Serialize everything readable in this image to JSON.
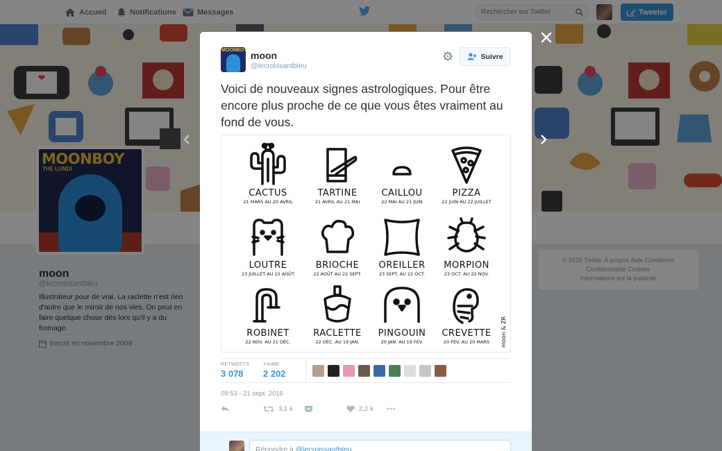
{
  "nav": {
    "home_label": "Accueil",
    "notifications_label": "Notifications",
    "messages_label": "Messages",
    "search_placeholder": "Rechercher sur Twitter",
    "tweet_button": "Tweeter"
  },
  "profile": {
    "avatar_title": "MOONBOY",
    "avatar_subtitle": "THE LUNDI",
    "name": "moon",
    "handle": "@lecroissantbleu",
    "bio": "Illustrateur pour de vrai. La raclette n'est rien d'autre que le miroir de nos vies. On peut en faire quelque chose dès lors qu'il y a du fromage.",
    "joined": "Inscrit en novembre 2009"
  },
  "footer": {
    "line1": "© 2016 Twitter   À propos   Aide   Conditions",
    "line2": "Confidentialité   Cookies",
    "line3": "Informations sur la publicité"
  },
  "tweet": {
    "author_name": "moon",
    "author_handle": "@lecroissantbleu",
    "follow_label": "Suivre",
    "text": "Voici de nouveaux signes astrologiques. Pour être encore plus proche de ce que vous êtes vraiment au fond de vous.",
    "retweets_label": "RETWEETS",
    "retweets_value": "3 078",
    "likes_label": "J'AIME",
    "likes_value": "2 202",
    "timestamp": "09:53 - 21 sept. 2016",
    "retweet_count": "3,1 k",
    "like_count": "2,2 k",
    "more_label": "•••",
    "reply_prefix": "Répondre à ",
    "reply_handle": "@lecroissantbleu"
  },
  "signs": [
    {
      "name": "CACTUS",
      "dates": "21 MARS AU 20 AVRIL",
      "icon": "cactus-icon"
    },
    {
      "name": "TARTINE",
      "dates": "21 AVRIL AU 21 MAI",
      "icon": "tartine-icon"
    },
    {
      "name": "CAILLOU",
      "dates": "22 MAI AU 21 JUIN",
      "icon": "caillou-icon"
    },
    {
      "name": "PIZZA",
      "dates": "22 JUIN AU 22 JUILLET",
      "icon": "pizza-icon"
    },
    {
      "name": "LOUTRE",
      "dates": "23 JUILLET AU 22 AOÛT",
      "icon": "loutre-icon"
    },
    {
      "name": "BRIOCHE",
      "dates": "22 AOÛT AU 22 SEPT.",
      "icon": "brioche-icon"
    },
    {
      "name": "OREILLER",
      "dates": "23 SEPT. AU 22 OCT.",
      "icon": "oreiller-icon"
    },
    {
      "name": "MORPION",
      "dates": "23 OCT. AU 22 NOV.",
      "icon": "morpion-icon"
    },
    {
      "name": "ROBINET",
      "dates": "22 NOV. AU 21 DÉC.",
      "icon": "robinet-icon"
    },
    {
      "name": "RACLETTE",
      "dates": "22 DÉC. AU 19 JAN.",
      "icon": "raclette-icon"
    },
    {
      "name": "PINGOUIN",
      "dates": "20 JAN. AU 19 FEV.",
      "icon": "pingouin-icon"
    },
    {
      "name": "CREVETTE",
      "dates": "20 FEV. AU 20 MARS",
      "icon": "crevette-icon"
    }
  ],
  "signature": "moon & ZR",
  "colors": {
    "accent": "#3b94d9",
    "overlay": "rgba(0,0,0,0.48)",
    "reply_bg": "#e8f5fd"
  }
}
